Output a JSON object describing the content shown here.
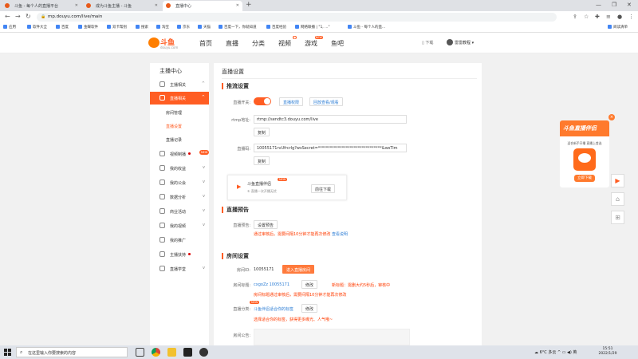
{
  "browser": {
    "tabs": [
      {
        "title": "斗鱼 - 每个人的直播平台"
      },
      {
        "title": "成为斗鱼主播 - 斗鱼"
      },
      {
        "title": "直播中心"
      }
    ],
    "url": "mp.douyu.com/live/main",
    "bookmarks": [
      "应用",
      "软件大全",
      "百度",
      "金蝶软件",
      "双卡帮别",
      "搜索",
      "淘宝",
      "京东",
      "天猫",
      "百度一下，你就知道",
      "百度经验",
      "网络联播 | \"1, ...\"",
      "斗鱼 - 每个人的直...",
      "阅读清单"
    ]
  },
  "site": {
    "logo_text": "斗鱼",
    "logo_url": "douyu.com",
    "nav": [
      {
        "label": "首页",
        "badge": ""
      },
      {
        "label": "直播",
        "badge": ""
      },
      {
        "label": "分类",
        "badge": ""
      },
      {
        "label": "视频",
        "badge": "●"
      },
      {
        "label": "游戏",
        "badge": "NEW"
      },
      {
        "label": "鱼吧",
        "badge": ""
      }
    ],
    "download": "下载",
    "username": "雷雷教程"
  },
  "sidebar": {
    "title": "主播中心",
    "items": [
      {
        "label": "主播相关"
      },
      {
        "label": "直播相关"
      },
      {
        "label": "视频制播"
      },
      {
        "label": "我的收益"
      },
      {
        "label": "我的公会"
      },
      {
        "label": "数据分析"
      },
      {
        "label": "商业活动"
      },
      {
        "label": "我的视频"
      },
      {
        "label": "我的推广"
      },
      {
        "label": "主播扶持"
      },
      {
        "label": "直播学堂"
      }
    ],
    "subitems": [
      "房间管理",
      "直播设置",
      "直播记录"
    ],
    "new_tag": "NEW"
  },
  "main": {
    "title": "直播设置",
    "push": {
      "heading": "推流设置",
      "switch_label": "直播开关:",
      "btn_mobile": "直播权限",
      "btn_playback": "回放查看/观看",
      "rtmp_label": "rtmp地址:",
      "rtmp_value": "rtmp://sendtc3.douyu.com/live",
      "copy": "复制",
      "code_label": "直播码:",
      "code_value": "10055171rvUfrcrIg?wsSecret=********************************&wsTim",
      "copy2": "复制",
      "partner_title": "斗鱼直播伴侣",
      "partner_desc": "① 直播一次开播无忧",
      "partner_new": "NEW",
      "partner_btn": "前往下载"
    },
    "preview": {
      "heading": "直播预告",
      "label": "直播预告:",
      "btn": "设置预告",
      "warn": "通过审核后，需要间隔10分钟才能再次修改",
      "link": "查看说明"
    },
    "room": {
      "heading": "房间设置",
      "id_label": "房间ID:",
      "id_value": "10055171",
      "id_btn": "进入直播房间",
      "title_label": "房间标题:",
      "title_value": "cxgoZz 10055171",
      "title_btn": "修改",
      "title_warn1": "新标题：需删大约5秒后，审核中",
      "title_warn2": "房间标题通过审核后，需要间隔10分钟才能再次修改",
      "cat_label": "直播分类:",
      "cat_value": "斗鱼伴侣适合你的标签",
      "cat_btn": "修改",
      "cat_new": "NEW",
      "cat_warn": "选择适合你的标签，获得更多曝光、人气哦~",
      "notice_label": "房间公告:"
    }
  },
  "ad": {
    "title": "斗鱼直播伴侣",
    "sub": "适合新手开播 直播上首选",
    "btn": "立即下载",
    "close": "×"
  },
  "taskbar": {
    "search_placeholder": "在这里输入你要搜索的内容",
    "weather": "6°C 多云",
    "time": "15:51",
    "date": "2022/1/29"
  }
}
